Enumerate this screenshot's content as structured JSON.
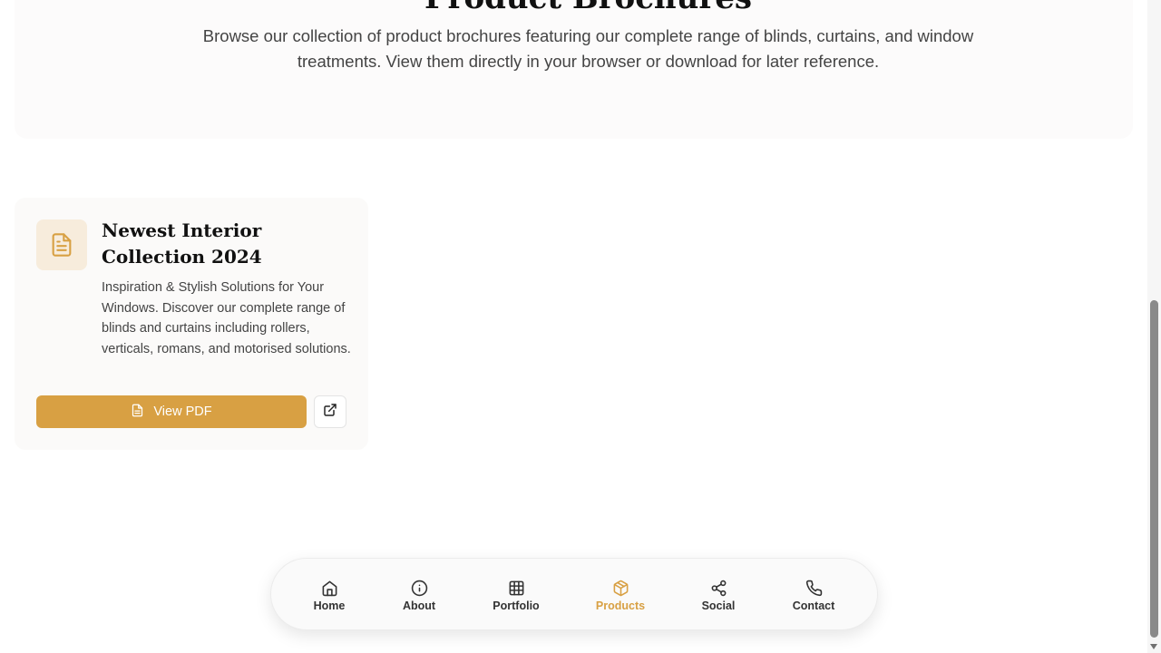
{
  "hero": {
    "title": "Product Brochures",
    "description": "Browse our collection of product brochures featuring our complete range of blinds, curtains, and window treatments. View them directly in your browser or download for later reference."
  },
  "brochure": {
    "icon": "file-text-icon",
    "title": "Newest Interior Collection 2024",
    "description": "Inspiration & Stylish Solutions for Your Windows. Discover our complete range of blinds and curtains including rollers, verticals, romans, and motorised solutions.",
    "view_label": "View PDF",
    "open_icon": "external-link-icon"
  },
  "nav": {
    "items": [
      {
        "label": "Home",
        "icon": "home-icon",
        "active": false
      },
      {
        "label": "About",
        "icon": "info-icon",
        "active": false
      },
      {
        "label": "Portfolio",
        "icon": "grid-icon",
        "active": false
      },
      {
        "label": "Products",
        "icon": "package-icon",
        "active": true
      },
      {
        "label": "Social",
        "icon": "share-icon",
        "active": false
      },
      {
        "label": "Contact",
        "icon": "phone-icon",
        "active": false
      }
    ]
  },
  "colors": {
    "accent": "#d8a043",
    "accent_light": "#f7ecdc",
    "text_dark": "#111111",
    "text_body": "#444444"
  }
}
